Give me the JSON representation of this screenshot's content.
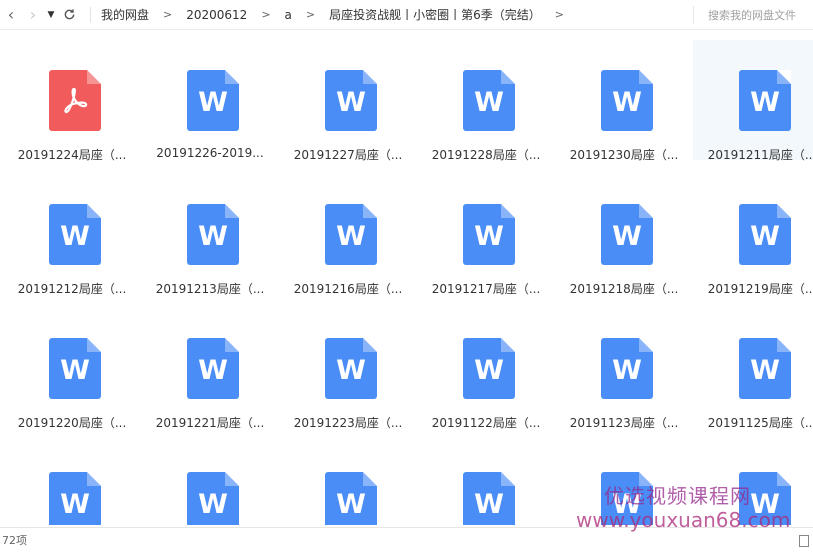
{
  "toolbar": {
    "back_icon": "chevron-left-icon",
    "forward_icon": "chevron-right-icon",
    "history_icon": "caret-down-icon",
    "refresh_icon": "refresh-icon",
    "breadcrumbs": [
      "我的网盘",
      "20200612",
      "a",
      "局座投资战舰丨小密圈丨第6季（完结）"
    ],
    "crumb_separator": ">",
    "search_placeholder": "搜索我的网盘文件"
  },
  "files": [
    {
      "name": "20191224局座（...",
      "type": "pdf"
    },
    {
      "name": "20191226-2019...",
      "type": "word"
    },
    {
      "name": "20191227局座（...",
      "type": "word"
    },
    {
      "name": "20191228局座（...",
      "type": "word"
    },
    {
      "name": "20191230局座（...",
      "type": "word"
    },
    {
      "name": "20191211局座（...",
      "type": "word",
      "selected": true
    },
    {
      "name": "20191212局座（...",
      "type": "word"
    },
    {
      "name": "20191213局座（...",
      "type": "word"
    },
    {
      "name": "20191216局座（...",
      "type": "word"
    },
    {
      "name": "20191217局座（...",
      "type": "word"
    },
    {
      "name": "20191218局座（...",
      "type": "word"
    },
    {
      "name": "20191219局座（...",
      "type": "word"
    },
    {
      "name": "20191220局座（...",
      "type": "word"
    },
    {
      "name": "20191221局座（...",
      "type": "word"
    },
    {
      "name": "20191223局座（...",
      "type": "word"
    },
    {
      "name": "20191122局座（...",
      "type": "word"
    },
    {
      "name": "20191123局座（...",
      "type": "word"
    },
    {
      "name": "20191125局座（...",
      "type": "word"
    },
    {
      "name": "",
      "type": "word"
    },
    {
      "name": "",
      "type": "word"
    },
    {
      "name": "",
      "type": "word"
    },
    {
      "name": "",
      "type": "word"
    },
    {
      "name": "",
      "type": "word"
    },
    {
      "name": "",
      "type": "word"
    }
  ],
  "word_letter": "W",
  "status": {
    "count": "72项"
  },
  "watermark": {
    "line1": "优选视频课程网",
    "line2": "www.youxuan68.com"
  },
  "colors": {
    "word": "#4a8df6",
    "pdf": "#f25b5b",
    "selected_bg": "#f3f8fd"
  }
}
